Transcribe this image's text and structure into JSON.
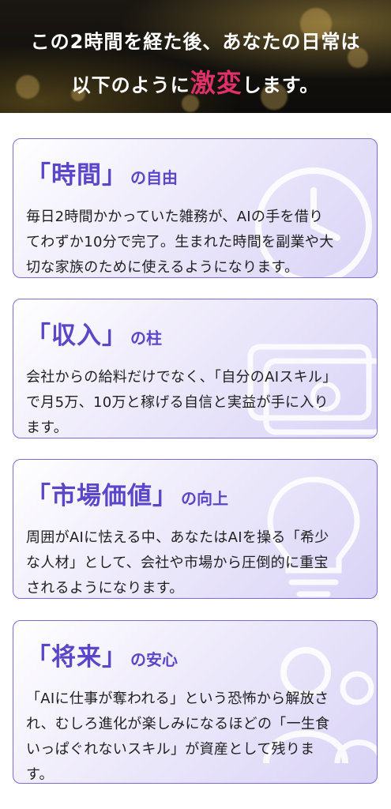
{
  "hero": {
    "line1": "この2時間を経た後、あなたの日常は",
    "line2_before": "以下のように",
    "line2_accent": "激変",
    "line2_after": "します。"
  },
  "cards": [
    {
      "title_main": "「時間」",
      "title_sub": "の自由",
      "body": "毎日2時間かかっていた雑務が、AIの手を借り\nてわずか10分で完了。生まれた時間を副業や大\n切な家族のために使えるようになります。",
      "icon": "clock-icon"
    },
    {
      "title_main": "「収入」",
      "title_sub": "の柱",
      "body": "会社からの給料だけでなく、「自分のAIスキル」\nで月5万、10万と稼げる自信と実益が手に入り\nます。",
      "icon": "money-icon"
    },
    {
      "title_main": "「市場価値」",
      "title_sub": "の向上",
      "body": " 周囲がAIに怯える中、あなたはAIを操る「希少\nな人材」として、会社や市場から圧倒的に重宝\nされるようになります。",
      "icon": "lightbulb-icon"
    },
    {
      "title_main": "「将来」",
      "title_sub": "の安心",
      "body": "「AIに仕事が奪われる」という恐怖から解放さ\nれ、むしろ進化が楽しみになるほどの「一生食\nいっぱぐれないスキル」が資産として残りま\nす。",
      "icon": "people-icon"
    }
  ],
  "colors": {
    "accent": "#e0306a",
    "title": "#5b45c9",
    "border": "#7d6ad6"
  }
}
